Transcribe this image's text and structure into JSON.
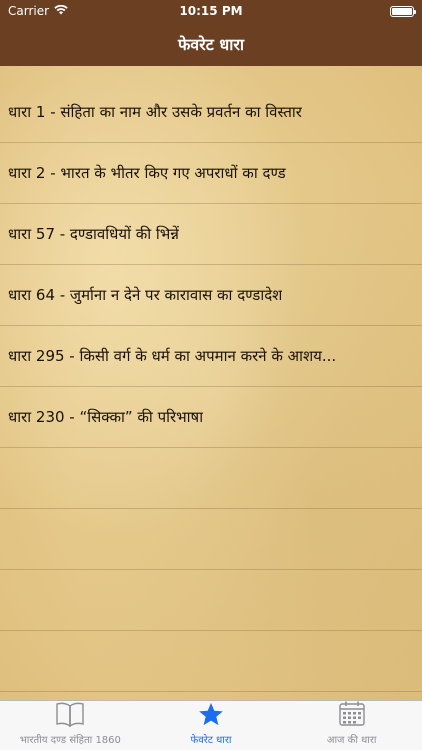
{
  "status_bar": {
    "carrier": "Carrier",
    "time": "10:15 PM"
  },
  "nav": {
    "title": "फेवरेट धारा"
  },
  "favorites": [
    "धारा 1 - संहिता का नाम और उसके प्रवर्तन का विस्तार",
    "धारा 2 - भारत के भीतर किए गए अपराधों का दण्ड",
    "धारा 57 - दण्डावधियों की भिन्नें",
    "धारा 64 - जुर्माना न देने पर कारावास का दण्डादेश",
    "धारा 295 - किसी वर्ग के धर्म का अपमान करने के आशय...",
    "धारा 230 - “सिक्का” की परिभाषा"
  ],
  "tabs": [
    {
      "label": "भारतीय दण्ड संहिता 1860",
      "icon": "book-icon"
    },
    {
      "label": "फेवरेट धारा",
      "icon": "star-icon"
    },
    {
      "label": "आज की धारा",
      "icon": "calendar-icon"
    }
  ],
  "colors": {
    "nav_bar": "#6b3f22",
    "parchment": "#e9d197",
    "tab_active": "#1a6cf0",
    "tab_inactive": "#8e8e93"
  }
}
